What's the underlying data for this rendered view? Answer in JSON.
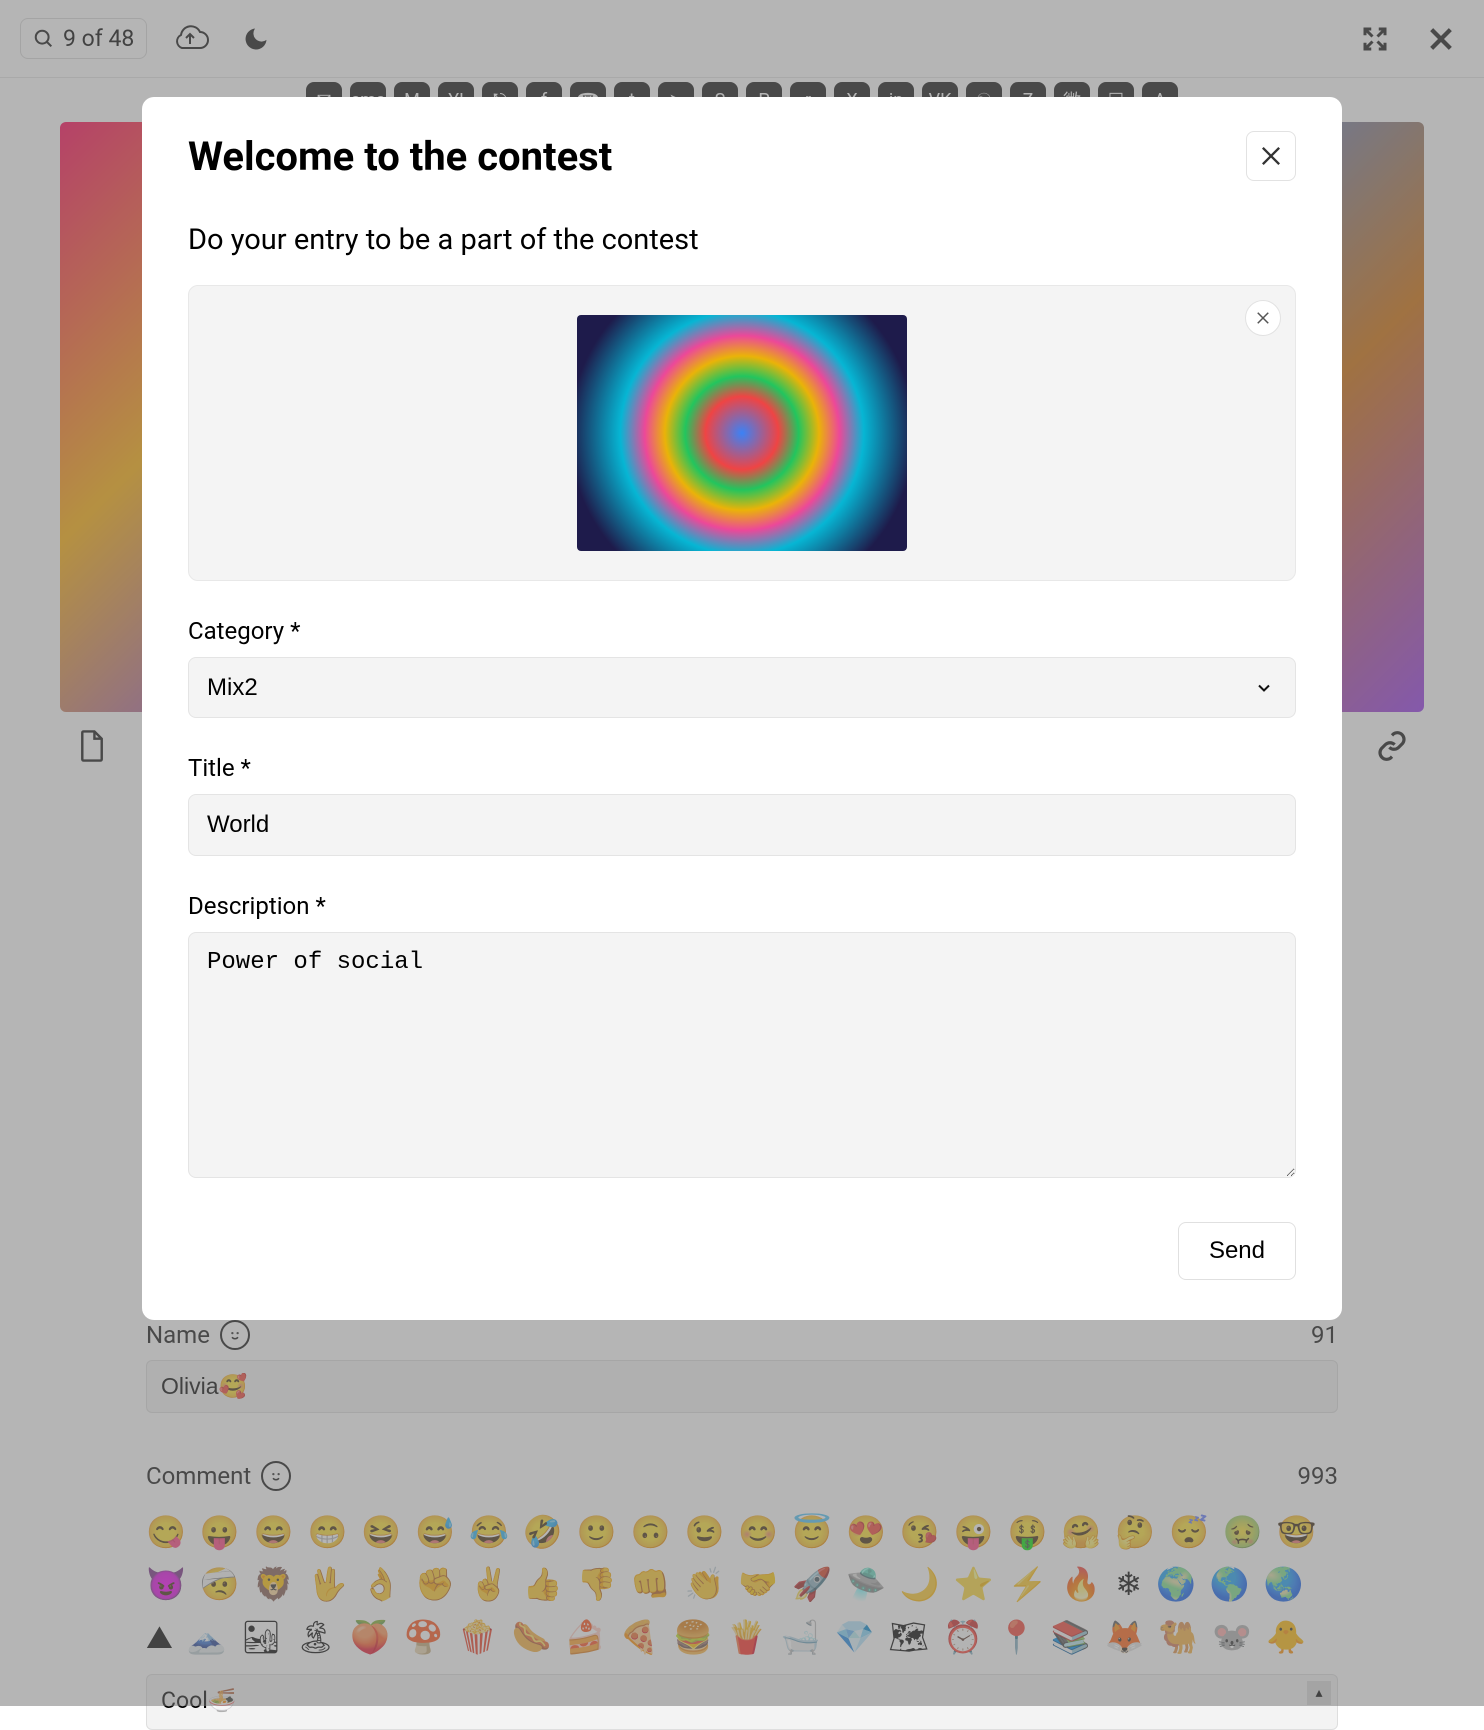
{
  "topbar": {
    "counter": "9 of 48"
  },
  "share_icons": [
    "✉",
    "sms",
    "M",
    "Y!",
    "⎋",
    "f",
    "☎",
    "t",
    "➤",
    "S",
    "P",
    "r",
    "X",
    "in",
    "VK",
    "☯",
    "Z",
    "微",
    "☐",
    "A"
  ],
  "below": {},
  "comments": {
    "name_label": "Name",
    "name_count": "91",
    "name_value": "Olivia🥰",
    "comment_label": "Comment",
    "comment_count": "993",
    "comment_value": "Cool🍜",
    "emojis": [
      "😋",
      "😛",
      "😄",
      "😁",
      "😆",
      "😅",
      "😂",
      "🤣",
      "🙂",
      "🙃",
      "😉",
      "😊",
      "😇",
      "😍",
      "😘",
      "😜",
      "🤑",
      "🤗",
      "🤔",
      "😴",
      "🤢",
      "🤓",
      "😈",
      "🤕",
      "🦁",
      "🖖",
      "👌",
      "✊",
      "✌",
      "👍",
      "👎",
      "👊",
      "👏",
      "🤝",
      "🚀",
      "🛸",
      "🌙",
      "⭐",
      "⚡",
      "🔥",
      "❄",
      "🌍",
      "🌎",
      "🌏",
      "⛰",
      "🗻",
      "🏜",
      "🏝",
      "🍑",
      "🍄",
      "🍿",
      "🌭",
      "🍰",
      "🍕",
      "🍔",
      "🍟",
      "🛁",
      "💎",
      "🗺",
      "⏰",
      "📍",
      "📚",
      "🦊",
      "🐫",
      "🐭",
      "🐥"
    ]
  },
  "modal": {
    "title": "Welcome to the contest",
    "subtitle": "Do your entry to be a part of the contest",
    "category_label": "Category *",
    "category_value": "Mix2",
    "title_label": "Title *",
    "title_value": "World",
    "description_label": "Description *",
    "description_value": "Power of social",
    "send_label": "Send"
  }
}
